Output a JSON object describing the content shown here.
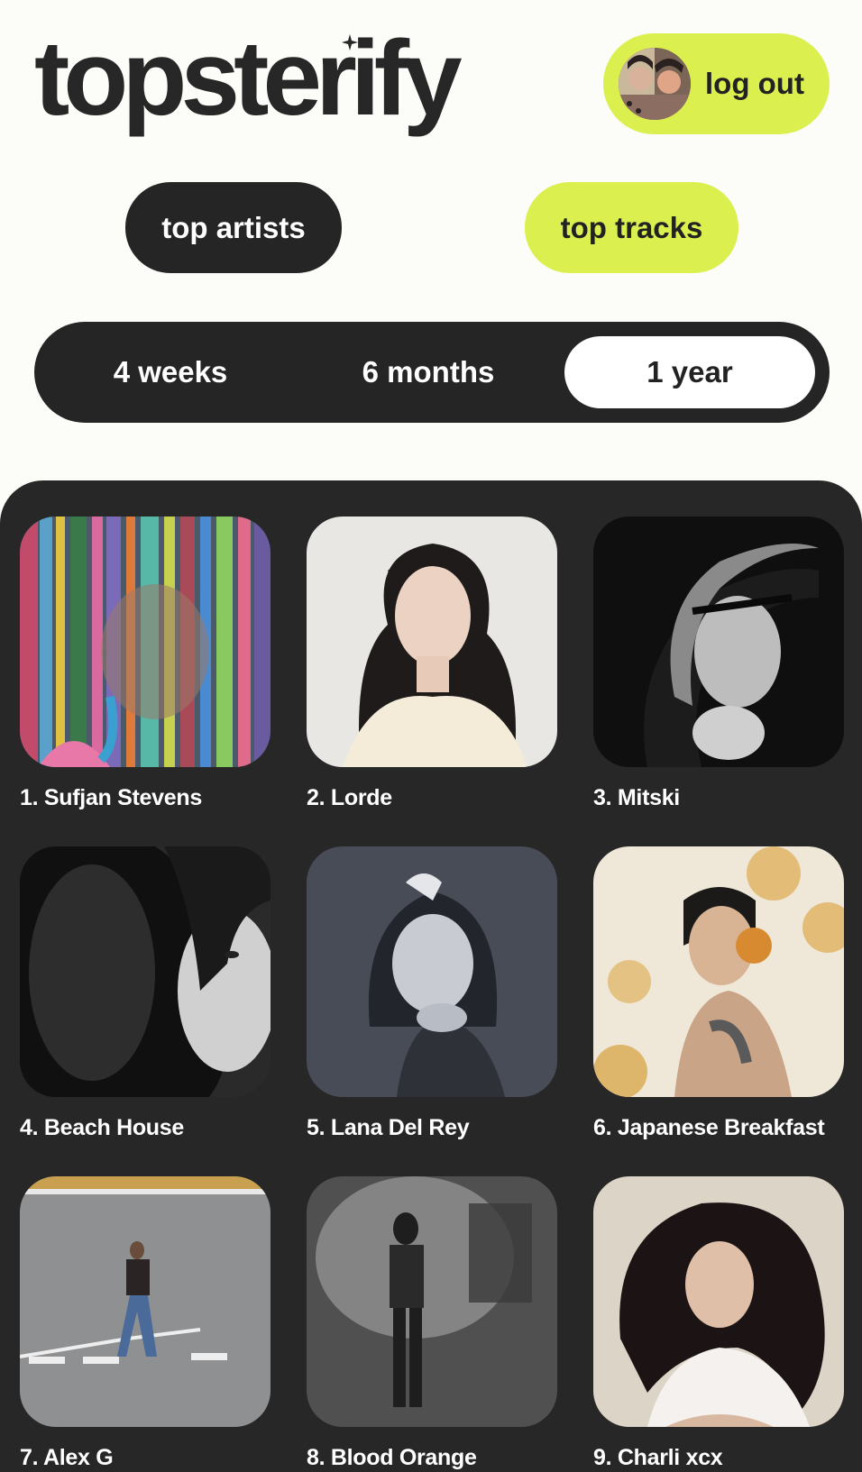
{
  "app": {
    "logo_text": "topsterify",
    "logout_label": "log out",
    "avatar_icon": "user-avatar"
  },
  "tabs": [
    {
      "label": "top artists",
      "selected": true
    },
    {
      "label": "top tracks",
      "selected": false
    }
  ],
  "time_ranges": [
    {
      "label": "4 weeks",
      "selected": false
    },
    {
      "label": "6 months",
      "selected": false
    },
    {
      "label": "1 year",
      "selected": true
    }
  ],
  "artists": [
    {
      "label": "1. Sufjan Stevens",
      "image_icon": "artist-photo-icon"
    },
    {
      "label": "2. Lorde",
      "image_icon": "artist-photo-icon"
    },
    {
      "label": "3. Mitski",
      "image_icon": "artist-photo-icon"
    },
    {
      "label": "4. Beach House",
      "image_icon": "artist-photo-icon"
    },
    {
      "label": "5. Lana Del Rey",
      "image_icon": "artist-photo-icon"
    },
    {
      "label": "6. Japanese Breakfast",
      "image_icon": "artist-photo-icon"
    },
    {
      "label": "7. Alex G",
      "image_icon": "artist-photo-icon"
    },
    {
      "label": "8. Blood Orange",
      "image_icon": "artist-photo-icon"
    },
    {
      "label": "9. Charli xcx",
      "image_icon": "artist-photo-icon"
    }
  ],
  "colors": {
    "accent": "#dbf04f",
    "dark": "#252525",
    "background": "#fcfcf9"
  }
}
